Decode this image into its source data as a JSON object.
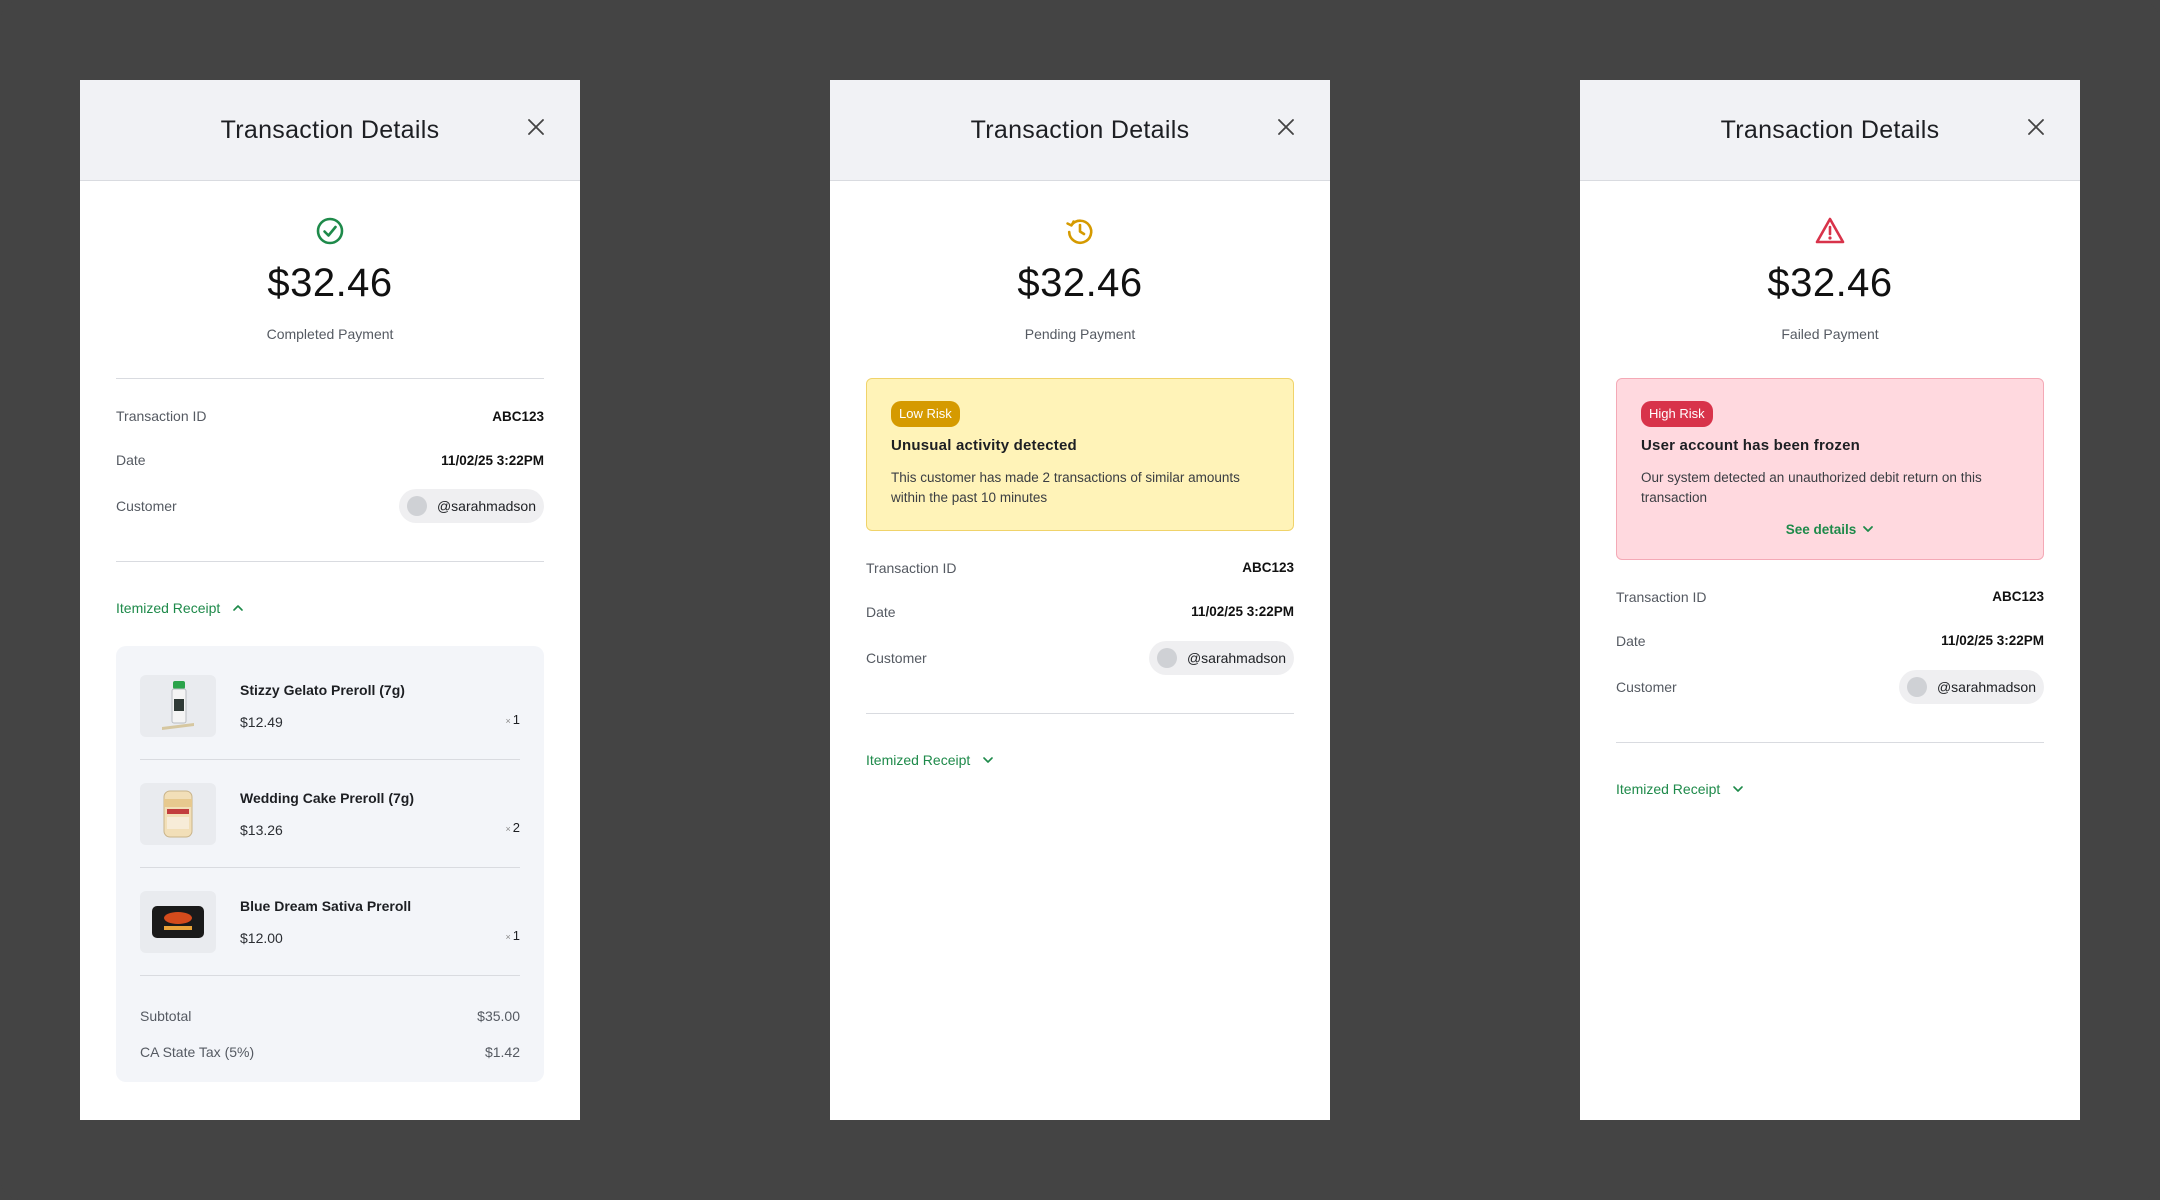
{
  "common": {
    "title": "Transaction Details",
    "amount": "$32.46",
    "transaction_id_label": "Transaction ID",
    "transaction_id": "ABC123",
    "date_label": "Date",
    "date": "11/02/25 3:22PM",
    "customer_label": "Customer",
    "customer_handle": "@sarahmadson",
    "receipt_label": "Itemized Receipt"
  },
  "panels": [
    {
      "status_icon": "check-circle-icon",
      "status_color": "#1e8a4a",
      "status_label": "Completed Payment",
      "receipt_expanded": true,
      "receipt": {
        "items": [
          {
            "name": "Stizzy Gelato Preroll (7g)",
            "price": "$12.49",
            "qty_prefix": "×",
            "qty": "1",
            "image": "preroll-tube-image"
          },
          {
            "name": "Wedding Cake Preroll (7g)",
            "price": "$13.26",
            "qty_prefix": "×",
            "qty": "2",
            "image": "preroll-jar-image"
          },
          {
            "name": "Blue Dream Sativa Preroll",
            "price": "$12.00",
            "qty_prefix": "×",
            "qty": "1",
            "image": "preroll-tin-image"
          }
        ],
        "subtotal_label": "Subtotal",
        "subtotal": "$35.00",
        "tax_label": "CA State Tax (5%)",
        "tax": "$1.42"
      }
    },
    {
      "status_icon": "history-clock-icon",
      "status_color": "#d59a00",
      "status_label": "Pending Payment",
      "receipt_expanded": false,
      "alert": {
        "badge": "Low Risk",
        "title": "Unusual activity detected",
        "text": "This customer has made 2 transactions of similar amounts within the past 10 minutes"
      }
    },
    {
      "status_icon": "warning-triangle-icon",
      "status_color": "#d8334a",
      "status_label": "Failed Payment",
      "receipt_expanded": false,
      "alert": {
        "badge": "High Risk",
        "title": "User account has been frozen",
        "text": "Our system detected an unauthorized debit return on this transaction",
        "link": "See details"
      }
    }
  ],
  "colors": {
    "background": "#444444",
    "accent_green": "#1e8a4a",
    "warning_yellow": "#fff3b8",
    "danger_pink": "#ffd9df"
  }
}
